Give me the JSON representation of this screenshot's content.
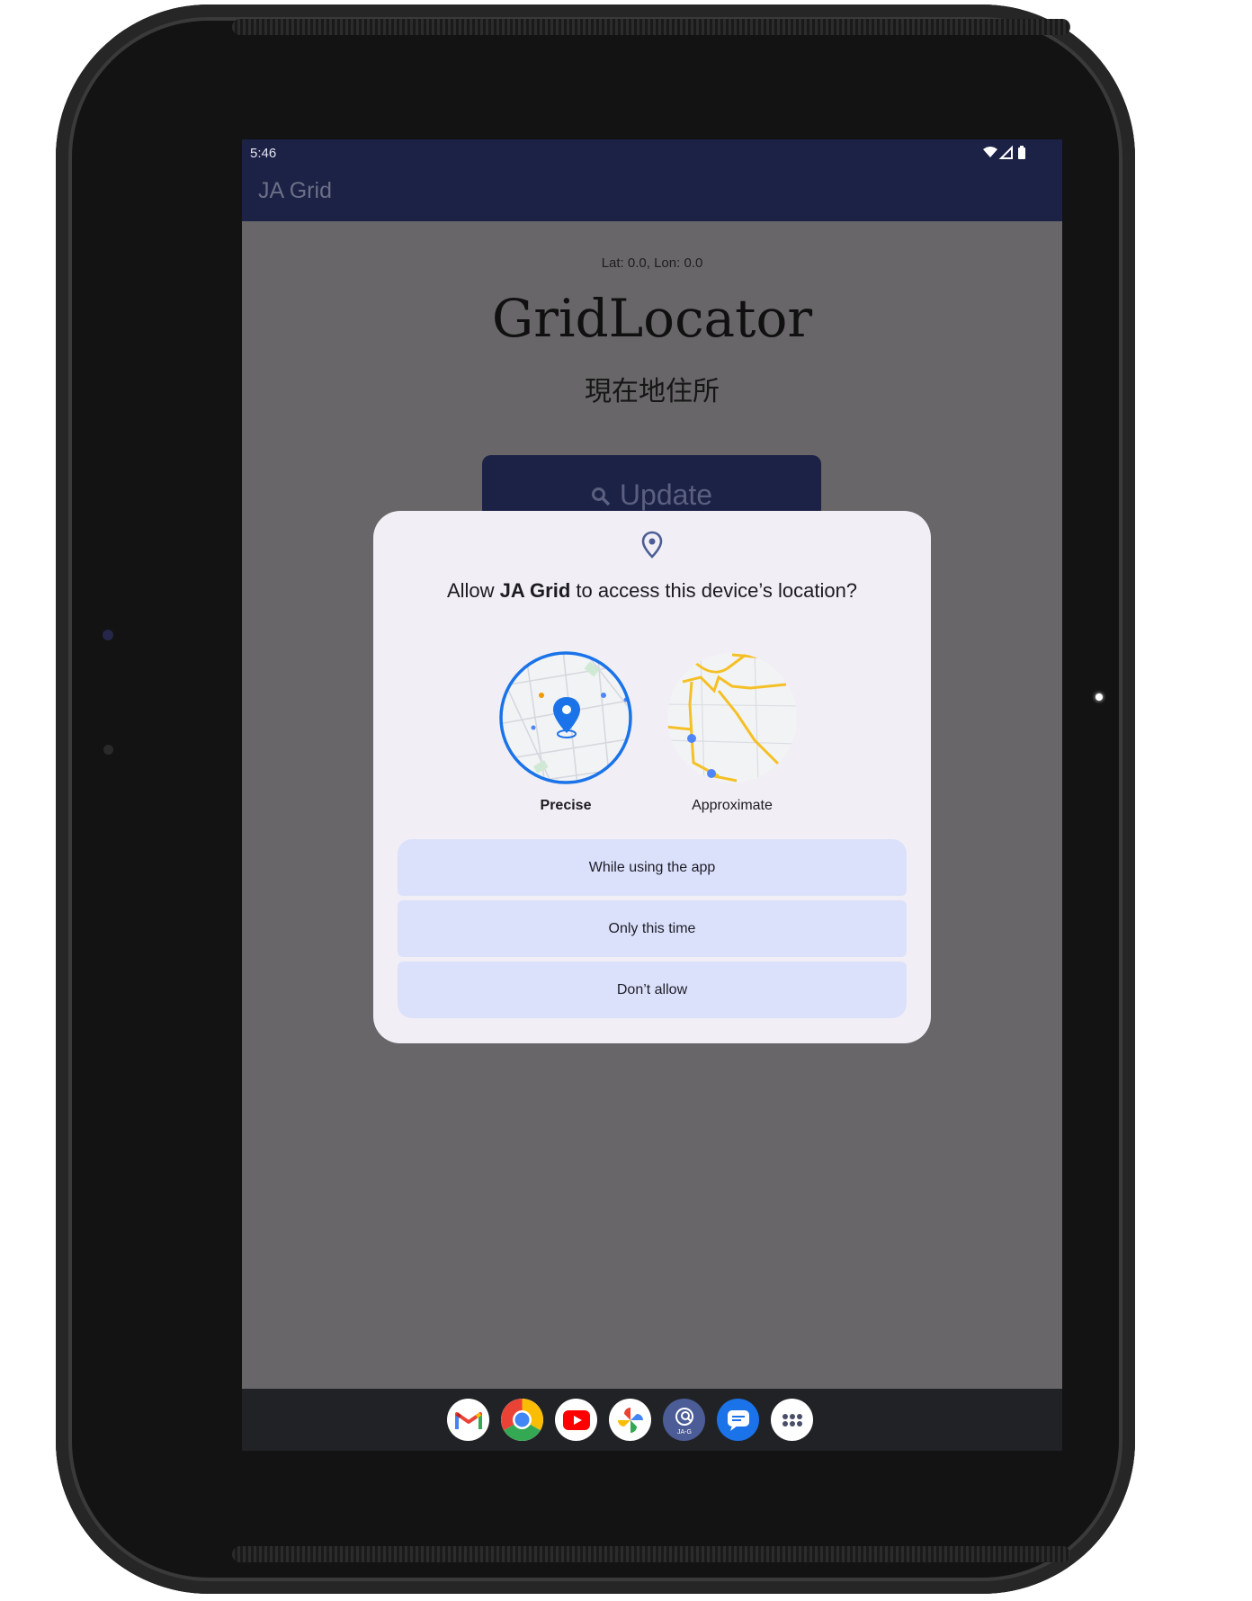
{
  "status_bar": {
    "time": "5:46"
  },
  "app": {
    "title": "JA Grid",
    "coordinates": "Lat: 0.0, Lon: 0.0",
    "heading": "GridLocator",
    "address": "現在地住所",
    "update_label": "Update",
    "colors": {
      "appbar": "#1c2146",
      "scrim": "#686668"
    }
  },
  "dialog": {
    "title_prefix": "Allow ",
    "app_name": "JA Grid",
    "title_suffix": " to access this device’s location?",
    "precise_label": "Precise",
    "approximate_label": "Approximate",
    "choices": [
      "While using the app",
      "Only this time",
      "Don’t allow"
    ],
    "colors": {
      "background": "#f1eff5",
      "choice": "#dce1fb",
      "accent": "#1a73e8"
    }
  },
  "dock": {
    "icons": [
      "gmail-icon",
      "chrome-icon",
      "youtube-icon",
      "photos-icon",
      "ja-grid-icon",
      "messages-icon",
      "app-drawer-icon"
    ],
    "ja_grid_badge": "JA-G"
  }
}
